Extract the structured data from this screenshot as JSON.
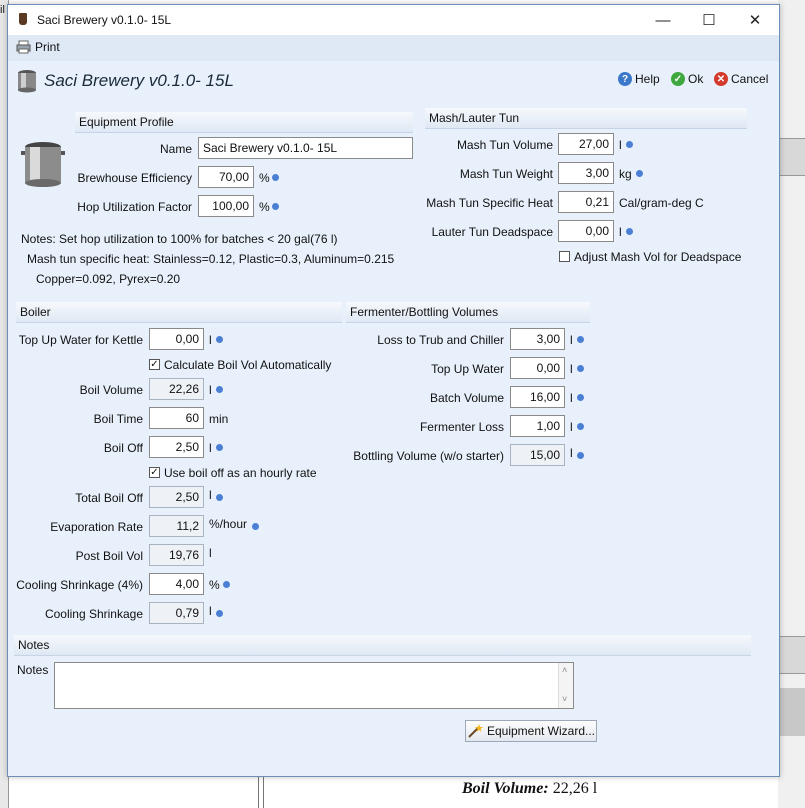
{
  "window": {
    "title": "Saci Brewery  v0.1.0- 15L",
    "minimize": "—",
    "maximize": "☐",
    "close": "✕"
  },
  "menu": {
    "print_label": "Print"
  },
  "header": {
    "title": "Saci Brewery  v0.1.0- 15L",
    "help_label": "Help",
    "ok_label": "Ok",
    "cancel_label": "Cancel"
  },
  "equipment_profile": {
    "title": "Equipment Profile",
    "name_label": "Name",
    "name_value": "Saci Brewery  v0.1.0- 15L",
    "efficiency_label": "Brewhouse Efficiency",
    "efficiency_value": "70,00",
    "efficiency_unit": "%",
    "hop_label": "Hop Utilization Factor",
    "hop_value": "100,00",
    "hop_unit": "%",
    "notes": [
      "Notes: Set hop utilization to 100% for batches < 20 gal(76 l)",
      "Mash tun specific heat: Stainless=0.12, Plastic=0.3, Aluminum=0.215",
      "Copper=0.092, Pyrex=0.20"
    ]
  },
  "mash": {
    "title": "Mash/Lauter Tun",
    "volume_label": "Mash Tun Volume",
    "volume_value": "27,00",
    "volume_unit": "l",
    "weight_label": "Mash Tun Weight",
    "weight_value": "3,00",
    "weight_unit": "kg",
    "heat_label": "Mash Tun Specific Heat",
    "heat_value": "0,21",
    "heat_unit": "Cal/gram-deg C",
    "deadspace_label": "Lauter Tun Deadspace",
    "deadspace_value": "0,00",
    "deadspace_unit": "l",
    "adjust_label": "Adjust Mash Vol for Deadspace",
    "adjust_checked": false
  },
  "boiler": {
    "title": "Boiler",
    "topup_label": "Top Up Water for Kettle",
    "topup_value": "0,00",
    "topup_unit": "l",
    "calc_label": "Calculate Boil Vol Automatically",
    "calc_checked": true,
    "boil_volume_label": "Boil Volume",
    "boil_volume_value": "22,26",
    "boil_volume_unit": "l",
    "boil_time_label": "Boil Time",
    "boil_time_value": "60",
    "boil_time_unit": "min",
    "boil_off_label": "Boil Off",
    "boil_off_value": "2,50",
    "boil_off_unit": "l",
    "hourly_label": "Use boil off as an hourly rate",
    "hourly_checked": true,
    "total_boil_off_label": "Total Boil Off",
    "total_boil_off_value": "2,50",
    "total_boil_off_unit": "l",
    "evap_label": "Evaporation Rate",
    "evap_value": "11,2",
    "evap_unit": "%/hour",
    "post_boil_label": "Post Boil Vol",
    "post_boil_value": "19,76",
    "post_boil_unit": "l",
    "cool_pct_label": "Cooling Shrinkage (4%)",
    "cool_pct_value": "4,00",
    "cool_pct_unit": "%",
    "cool_label": "Cooling Shrinkage",
    "cool_value": "0,79",
    "cool_unit": "l"
  },
  "fermenter": {
    "title": "Fermenter/Bottling Volumes",
    "trub_label": "Loss to Trub and Chiller",
    "trub_value": "3,00",
    "trub_unit": "l",
    "topup_label": "Top Up Water",
    "topup_value": "0,00",
    "topup_unit": "l",
    "batch_label": "Batch Volume",
    "batch_value": "16,00",
    "batch_unit": "l",
    "loss_label": "Fermenter Loss",
    "loss_value": "1,00",
    "loss_unit": "l",
    "bottling_label": "Bottling Volume (w/o starter)",
    "bottling_value": "15,00",
    "bottling_unit": "l"
  },
  "notes_section": {
    "title": "Notes",
    "label": "Notes",
    "value": ""
  },
  "wizard_label": "Equipment Wizard...",
  "background": {
    "line1_label": "Boil Volume:",
    "line1_value": "22,26 l",
    "sidebar_char": "il"
  },
  "colors": {
    "accent": "#4a7fd4",
    "window_bg": "#e8f1fb"
  }
}
